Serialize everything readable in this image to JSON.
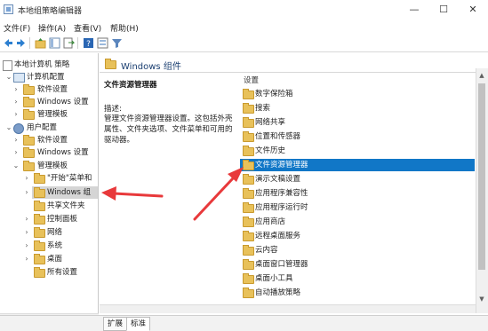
{
  "window": {
    "title": "本地组策略编辑器",
    "minimize_glyph": "—",
    "maximize_glyph": "☐",
    "close_glyph": "✕"
  },
  "menu": [
    "文件(F)",
    "操作(A)",
    "查看(V)",
    "帮助(H)"
  ],
  "toolbar_icons": [
    "back-icon",
    "forward-icon",
    "up-folder-icon",
    "show-hide-tree-icon",
    "export-list-icon",
    "help-icon",
    "properties-icon",
    "filter-icon"
  ],
  "tree": {
    "root": "本地计算机 策略",
    "computer_config": "计算机配置",
    "cc_software": "软件设置",
    "cc_windows": "Windows 设置",
    "cc_admin": "管理模板",
    "user_config": "用户配置",
    "uc_software": "软件设置",
    "uc_windows": "Windows 设置",
    "uc_admin": "管理模板",
    "start_menu": "\"开始\"菜单和",
    "windows_components": "Windows 组",
    "shared_folders": "共享文件夹",
    "control_panel": "控制面板",
    "network": "网络",
    "system": "系统",
    "desktop": "桌面",
    "all_settings": "所有设置"
  },
  "content": {
    "header": "Windows 组件",
    "selected_title": "文件资源管理器",
    "description_heading": "描述:",
    "description": "管理文件资源管理器设置。这包括外壳属性、文件夹选项、文件菜单和可用的驱动器。"
  },
  "list": {
    "column_header": "设置",
    "items": [
      "数字保险箱",
      "搜索",
      "网络共享",
      "位置和传感器",
      "文件历史",
      "文件资源管理器",
      "演示文稿设置",
      "应用程序兼容性",
      "应用程序运行时",
      "应用商店",
      "远程桌面服务",
      "云内容",
      "桌面窗口管理器",
      "桌面小工具",
      "自动播放策略"
    ],
    "selected_index": 5
  },
  "tabs": [
    "扩展",
    "标准"
  ],
  "colors": {
    "selection": "#1177c7",
    "annotation_arrow": "#e8393b",
    "folder": "#e8c15a"
  }
}
